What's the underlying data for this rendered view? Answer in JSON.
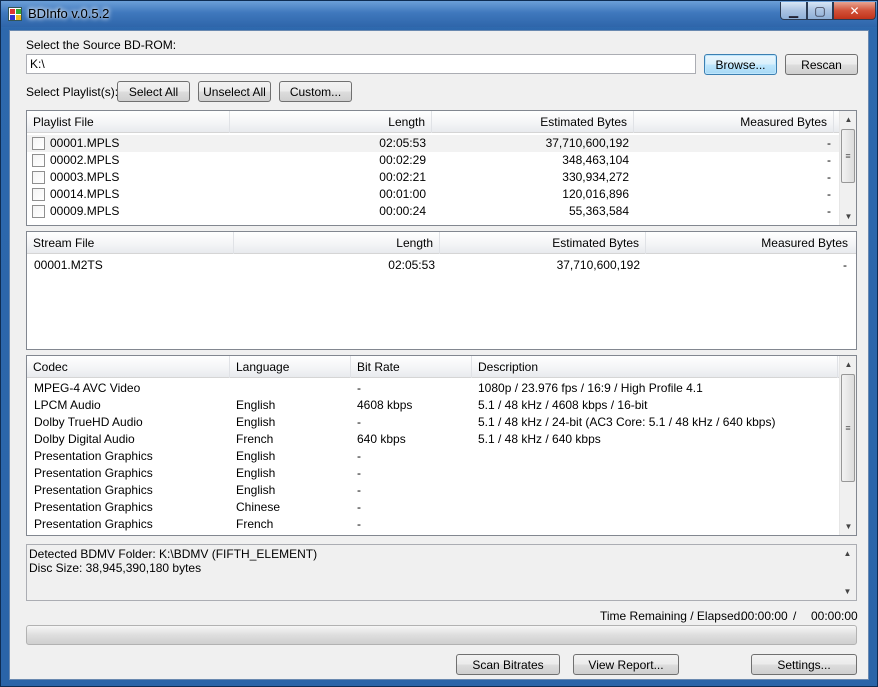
{
  "window": {
    "title": "BDInfo v.0.5.2",
    "min_glyph": "▁",
    "max_glyph": "▢",
    "close_glyph": "✕"
  },
  "source": {
    "label": "Select the Source BD-ROM:",
    "path": "K:\\",
    "browse_label": "Browse...",
    "rescan_label": "Rescan"
  },
  "playlists": {
    "label": "Select Playlist(s):",
    "select_all_label": "Select All",
    "unselect_all_label": "Unselect All",
    "custom_label": "Custom...",
    "columns": [
      "Playlist File",
      "Length",
      "Estimated Bytes",
      "Measured Bytes"
    ],
    "rows": [
      {
        "file": "00001.MPLS",
        "length": "02:05:53",
        "estimated": "37,710,600,192",
        "measured": "-"
      },
      {
        "file": "00002.MPLS",
        "length": "00:02:29",
        "estimated": "348,463,104",
        "measured": "-"
      },
      {
        "file": "00003.MPLS",
        "length": "00:02:21",
        "estimated": "330,934,272",
        "measured": "-"
      },
      {
        "file": "00014.MPLS",
        "length": "00:01:00",
        "estimated": "120,016,896",
        "measured": "-"
      },
      {
        "file": "00009.MPLS",
        "length": "00:00:24",
        "estimated": "55,363,584",
        "measured": "-"
      }
    ]
  },
  "streams": {
    "columns": [
      "Stream File",
      "Length",
      "Estimated Bytes",
      "Measured Bytes"
    ],
    "rows": [
      {
        "file": "00001.M2TS",
        "length": "02:05:53",
        "estimated": "37,710,600,192",
        "measured": "-"
      }
    ]
  },
  "codecs": {
    "columns": [
      "Codec",
      "Language",
      "Bit Rate",
      "Description"
    ],
    "rows": [
      {
        "codec": "MPEG-4 AVC Video",
        "language": "",
        "bitrate": "-",
        "description": "1080p / 23.976 fps / 16:9 / High Profile 4.1"
      },
      {
        "codec": "LPCM Audio",
        "language": "English",
        "bitrate": "4608 kbps",
        "description": "5.1 / 48 kHz / 4608 kbps / 16-bit"
      },
      {
        "codec": "Dolby TrueHD Audio",
        "language": "English",
        "bitrate": "-",
        "description": "5.1 / 48 kHz / 24-bit (AC3 Core: 5.1 / 48 kHz / 640 kbps)"
      },
      {
        "codec": "Dolby Digital Audio",
        "language": "French",
        "bitrate": "640 kbps",
        "description": "5.1 / 48 kHz / 640 kbps"
      },
      {
        "codec": "Presentation Graphics",
        "language": "English",
        "bitrate": "-",
        "description": ""
      },
      {
        "codec": "Presentation Graphics",
        "language": "English",
        "bitrate": "-",
        "description": ""
      },
      {
        "codec": "Presentation Graphics",
        "language": "English",
        "bitrate": "-",
        "description": ""
      },
      {
        "codec": "Presentation Graphics",
        "language": "Chinese",
        "bitrate": "-",
        "description": ""
      },
      {
        "codec": "Presentation Graphics",
        "language": "French",
        "bitrate": "-",
        "description": ""
      }
    ]
  },
  "info": {
    "line1": "Detected BDMV Folder: K:\\BDMV (FIFTH_ELEMENT)",
    "line2": "Disc Size: 38,945,390,180 bytes"
  },
  "status": {
    "time_label": "Time Remaining / Elapsed:",
    "remaining": "00:00:00",
    "separator": "/",
    "elapsed": "00:00:00",
    "progress": 0
  },
  "footer": {
    "scan_label": "Scan Bitrates",
    "report_label": "View Report...",
    "settings_label": "Settings..."
  },
  "scroll": {
    "up_glyph": "▲",
    "down_glyph": "▼",
    "grip_glyph": "≡"
  }
}
